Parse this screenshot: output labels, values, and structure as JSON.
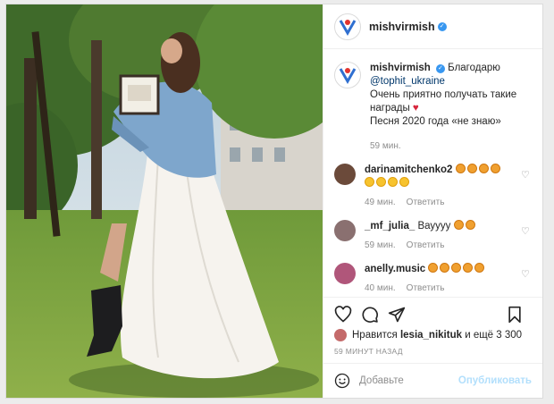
{
  "header": {
    "username": "mishvirmish",
    "avatar_icon": "user-logo-icon"
  },
  "caption": {
    "username": "mishvirmish",
    "line1": "Благодарю",
    "mention": "@tophit_ukraine",
    "line2": "Очень приятно получать такие награды",
    "line3": "Песня 2020 года «не знаю»",
    "time": "59 мин."
  },
  "comments": [
    {
      "username": "darinamitchenko2",
      "text": "",
      "emoji_count": 4,
      "emoji_count2": 4,
      "time": "49 мин.",
      "reply": "Ответить",
      "avatar_color": "#6b4a3a"
    },
    {
      "username": "_mf_julia_",
      "text": "Вауууу",
      "emoji_count": 2,
      "time": "59 мин.",
      "reply": "Ответить",
      "avatar_color": "#8a7070"
    },
    {
      "username": "anelly.music",
      "text": "",
      "emoji_count": 5,
      "time": "40 мин.",
      "reply": "Ответить",
      "avatar_color": "#b0567a"
    }
  ],
  "likes": {
    "prefix": "Нравится",
    "user": "lesia_nikituk",
    "suffix": "и ещё 3 300"
  },
  "timestamp": "59 МИНУТ НАЗАД",
  "add_comment": {
    "placeholder": "Добавьте",
    "publish": "Опубликовать"
  }
}
